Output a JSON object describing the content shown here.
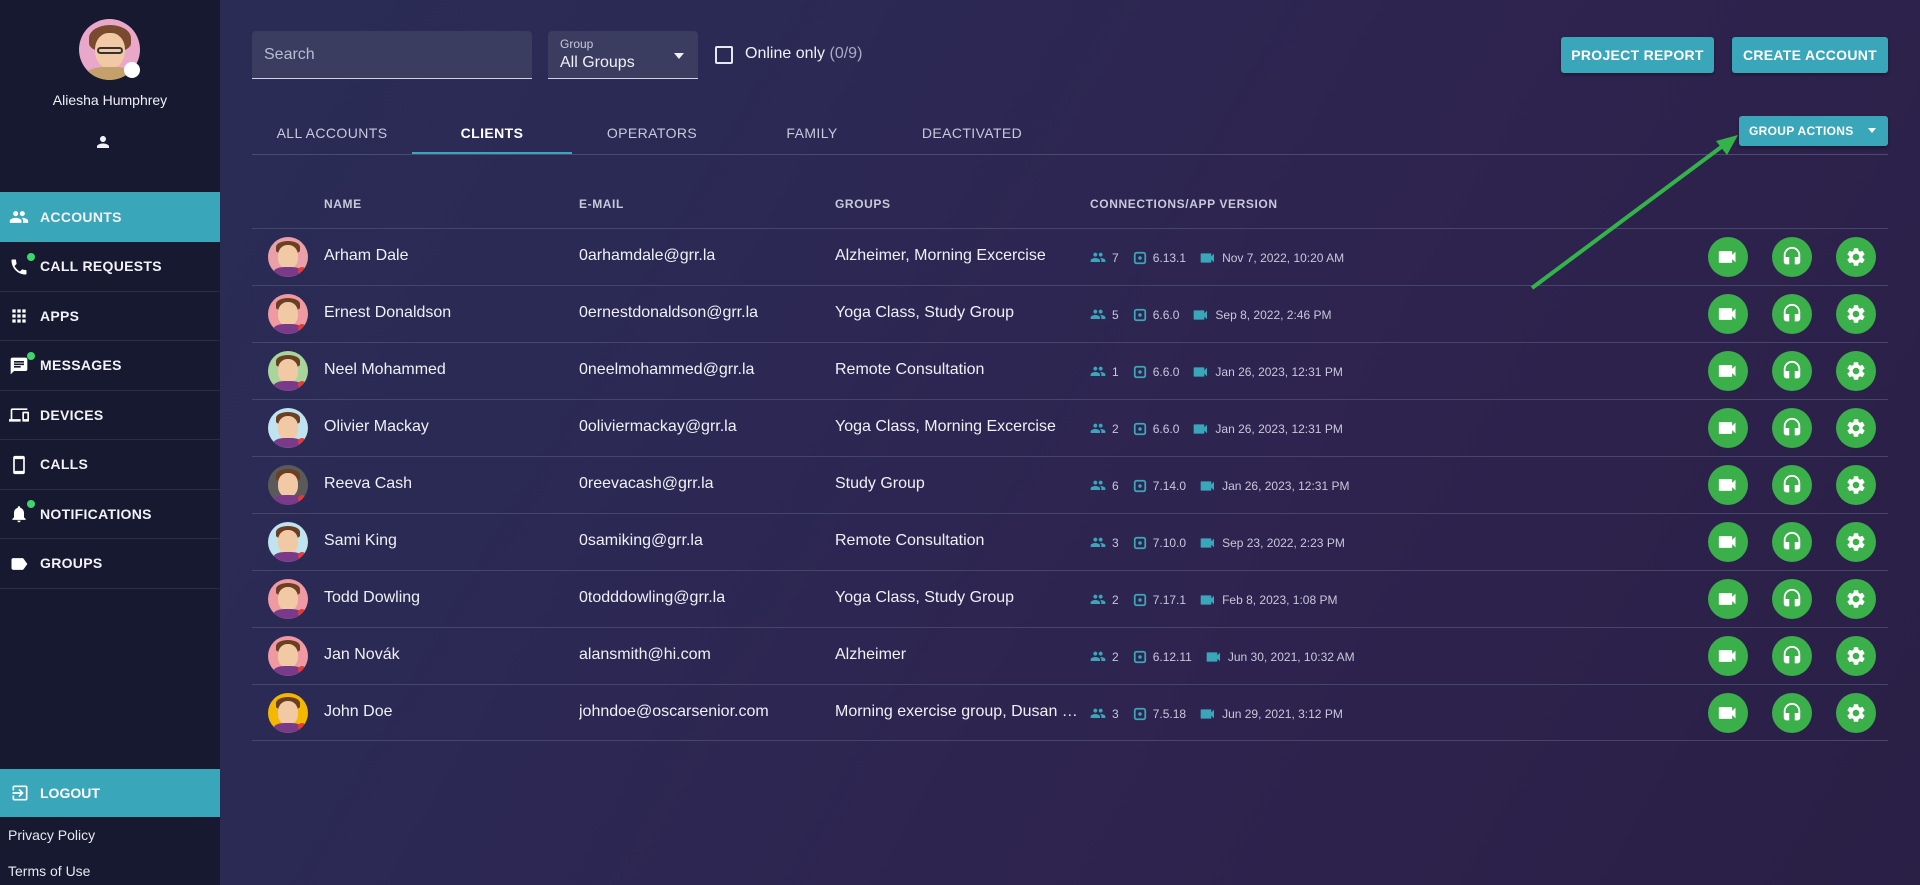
{
  "user": {
    "name": "Aliesha Humphrey"
  },
  "sidebar": {
    "items": [
      {
        "label": "ACCOUNTS",
        "icon": "people-icon",
        "active": true,
        "dot": false
      },
      {
        "label": "CALL REQUESTS",
        "icon": "phone-icon",
        "active": false,
        "dot": true
      },
      {
        "label": "APPS",
        "icon": "apps-grid-icon",
        "active": false,
        "dot": false
      },
      {
        "label": "MESSAGES",
        "icon": "message-icon",
        "active": false,
        "dot": true
      },
      {
        "label": "DEVICES",
        "icon": "devices-icon",
        "active": false,
        "dot": false
      },
      {
        "label": "CALLS",
        "icon": "smartphone-icon",
        "active": false,
        "dot": false
      },
      {
        "label": "NOTIFICATIONS",
        "icon": "bell-icon",
        "active": false,
        "dot": true
      },
      {
        "label": "GROUPS",
        "icon": "label-icon",
        "active": false,
        "dot": false
      }
    ],
    "logout": "LOGOUT",
    "privacy": "Privacy Policy",
    "terms": "Terms of Use"
  },
  "toolbar": {
    "search_placeholder": "Search",
    "group_label": "Group",
    "group_value": "All Groups",
    "online_label": "Online only",
    "online_count": "(0/9)",
    "project_report": "PROJECT REPORT",
    "create_account": "CREATE ACCOUNT",
    "group_actions": "GROUP ACTIONS"
  },
  "tabs": [
    "ALL ACCOUNTS",
    "CLIENTS",
    "OPERATORS",
    "FAMILY",
    "DEACTIVATED"
  ],
  "active_tab": "CLIENTS",
  "table": {
    "headers": {
      "name": "NAME",
      "email": "E-MAIL",
      "groups": "GROUPS",
      "connections": "CONNECTIONS/APP VERSION"
    },
    "rows": [
      {
        "name": "Arham Dale",
        "email": "0arhamdale@grr.la",
        "groups": "Alzheimer, Morning Excercise",
        "connections": "7",
        "version": "6.13.1",
        "last_call": "Nov 7, 2022, 10:20 AM",
        "avatar_bg": "#e9a0a8"
      },
      {
        "name": "Ernest Donaldson",
        "email": "0ernestdonaldson@grr.la",
        "groups": "Yoga Class, Study Group",
        "connections": "5",
        "version": "6.6.0",
        "last_call": "Sep 8, 2022, 2:46 PM",
        "avatar_bg": "#ef9aa3"
      },
      {
        "name": "Neel Mohammed",
        "email": "0neelmohammed@grr.la",
        "groups": "Remote Consultation",
        "connections": "1",
        "version": "6.6.0",
        "last_call": "Jan 26, 2023, 12:31 PM",
        "avatar_bg": "#a9d59a"
      },
      {
        "name": "Olivier Mackay",
        "email": "0oliviermackay@grr.la",
        "groups": "Yoga Class, Morning Excercise",
        "connections": "2",
        "version": "6.6.0",
        "last_call": "Jan 26, 2023, 12:31 PM",
        "avatar_bg": "#bfe3ef"
      },
      {
        "name": "Reeva Cash",
        "email": "0reevacash@grr.la",
        "groups": "Study Group",
        "connections": "6",
        "version": "7.14.0",
        "last_call": "Jan 26, 2023, 12:31 PM",
        "avatar_bg": "#5a5a5a"
      },
      {
        "name": "Sami King",
        "email": "0samiking@grr.la",
        "groups": "Remote Consultation",
        "connections": "3",
        "version": "7.10.0",
        "last_call": "Sep 23, 2022, 2:23 PM",
        "avatar_bg": "#bfe3ef"
      },
      {
        "name": "Todd Dowling",
        "email": "0todddowling@grr.la",
        "groups": "Yoga Class, Study Group",
        "connections": "2",
        "version": "7.17.1",
        "last_call": "Feb 8, 2023, 1:08 PM",
        "avatar_bg": "#ef9aa3"
      },
      {
        "name": "Jan Novák",
        "email": "alansmith@hi.com",
        "groups": "Alzheimer",
        "connections": "2",
        "version": "6.12.11",
        "last_call": "Jun 30, 2021, 10:32 AM",
        "avatar_bg": "#ef9aa3"
      },
      {
        "name": "John Doe",
        "email": "johndoe@oscarsenior.com",
        "groups": "Morning exercise group, Dusan …",
        "connections": "3",
        "version": "7.5.18",
        "last_call": "Jun 29, 2021, 3:12 PM",
        "avatar_bg": "#f5b800"
      }
    ]
  },
  "colors": {
    "accent": "#3aa6b9",
    "action_green": "#3aaf4a",
    "arrow_green": "#34b34a"
  }
}
